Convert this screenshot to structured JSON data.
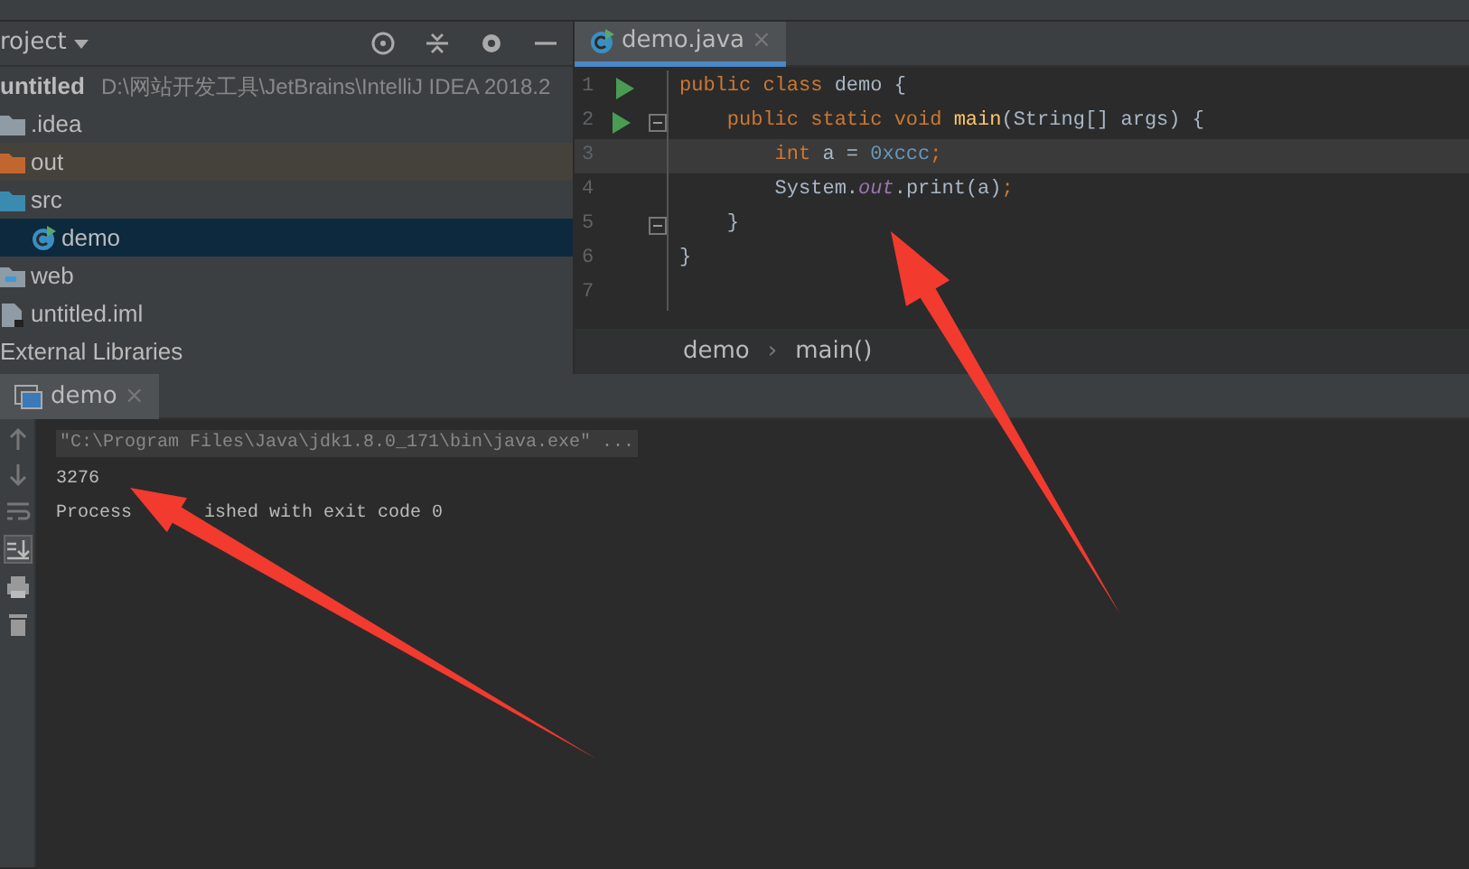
{
  "project_panel": {
    "title": "roject",
    "tree": [
      {
        "label": "untitled",
        "path": "D:\\网站开发工具\\JetBrains\\IntelliJ IDEA 2018.2",
        "kind": "module",
        "selected": false,
        "children": [
          {
            "label": ".idea",
            "kind": "folder",
            "selected": false
          },
          {
            "label": "out",
            "kind": "excluded-folder",
            "selected": false
          },
          {
            "label": "src",
            "kind": "source-folder",
            "selected": false,
            "children": [
              {
                "label": "demo",
                "kind": "class",
                "selected": true
              }
            ]
          },
          {
            "label": "web",
            "kind": "web-folder",
            "selected": false
          },
          {
            "label": "untitled.iml",
            "kind": "file",
            "selected": false
          }
        ]
      },
      {
        "label": "External Libraries",
        "kind": "libraries",
        "selected": false
      }
    ]
  },
  "editor": {
    "tabs": [
      {
        "label": "demo.java",
        "close": "×",
        "selected": true
      }
    ],
    "lines": [
      {
        "number": "1",
        "run": true,
        "fold": false,
        "current": false,
        "tokens": [
          {
            "text": "public class ",
            "kind": "keyword"
          },
          {
            "text": "demo {",
            "kind": "plain"
          }
        ]
      },
      {
        "number": "2",
        "run": true,
        "fold": true,
        "current": false,
        "tokens": [
          {
            "text": "    public static void ",
            "kind": "keyword"
          },
          {
            "text": "main",
            "kind": "method"
          },
          {
            "text": "(String[] args) {",
            "kind": "plain"
          }
        ]
      },
      {
        "number": "3",
        "run": false,
        "fold": false,
        "current": true,
        "tokens": [
          {
            "text": "        int ",
            "kind": "keyword"
          },
          {
            "text": "a = ",
            "kind": "plain"
          },
          {
            "text": "0xccc",
            "kind": "number"
          },
          {
            "text": ";",
            "kind": "keyword"
          }
        ]
      },
      {
        "number": "4",
        "run": false,
        "fold": false,
        "current": false,
        "tokens": [
          {
            "text": "        System.",
            "kind": "plain"
          },
          {
            "text": "out",
            "kind": "field"
          },
          {
            "text": ".print(a)",
            "kind": "plain"
          },
          {
            "text": ";",
            "kind": "keyword"
          }
        ]
      },
      {
        "number": "5",
        "run": false,
        "fold": true,
        "current": false,
        "tokens": [
          {
            "text": "    }",
            "kind": "plain"
          }
        ]
      },
      {
        "number": "6",
        "run": false,
        "fold": false,
        "current": false,
        "tokens": [
          {
            "text": "}",
            "kind": "plain"
          }
        ]
      },
      {
        "number": "7",
        "run": false,
        "fold": false,
        "current": false
      }
    ],
    "breadcrumbs": [
      "demo",
      "main()"
    ],
    "breadcrumb_separator": "›"
  },
  "run_panel": {
    "tabs": [
      {
        "label": "demo",
        "close": "×",
        "selected": true
      }
    ],
    "console": [
      {
        "kind": "command",
        "segments": [
          "\"C:\\Program Files\\Java\\jdk1.8.0_171\\bin\\java.exe\" ..."
        ]
      },
      {
        "kind": "output",
        "segments": [
          "3276"
        ]
      },
      {
        "kind": "output",
        "segments": [
          "Process",
          "ished with exit code 0"
        ]
      }
    ]
  },
  "annotations": [
    {
      "kind": "arrow"
    },
    {
      "kind": "arrow"
    }
  ]
}
